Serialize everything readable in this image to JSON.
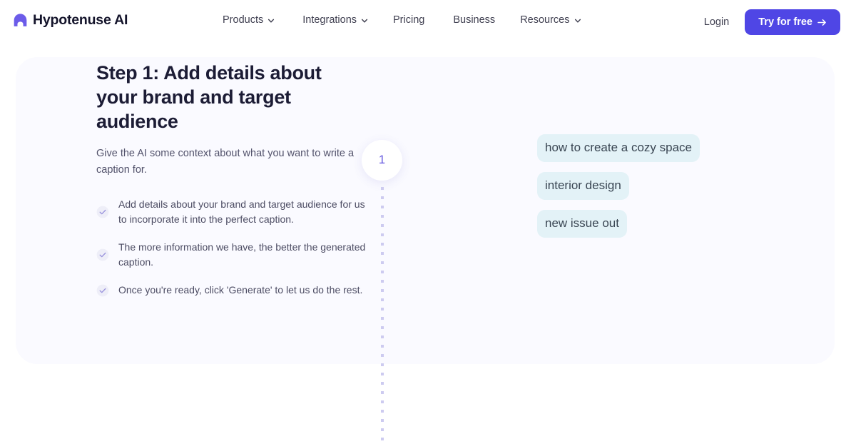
{
  "header": {
    "brand_name": "Hypotenuse AI",
    "brand_icon": "arch-logo-icon",
    "nav": [
      {
        "label": "Products",
        "has_dropdown": true,
        "icon": "chevron-down-icon"
      },
      {
        "label": "Integrations",
        "has_dropdown": true,
        "icon": "chevron-down-icon"
      },
      {
        "label": "Pricing",
        "has_dropdown": false,
        "icon": ""
      },
      {
        "label": "Business",
        "has_dropdown": false,
        "icon": ""
      },
      {
        "label": "Resources",
        "has_dropdown": true,
        "icon": "chevron-down-icon"
      }
    ],
    "login_label": "Login",
    "cta_label": "Try for free",
    "cta_icon": "arrow-right-icon",
    "cta_color": "#4f46e5"
  },
  "panel": {
    "background": "#fafaff",
    "title": "Step 1: Add details about your brand and target audience",
    "subtitle": "Give the AI some context about what you want to write a caption for.",
    "checklist": [
      {
        "icon": "check-circle-icon",
        "text": "Add details about your brand and target audience for us to incorporate it into the perfect caption."
      },
      {
        "icon": "check-circle-icon",
        "text": "The more information we have, the better the generated caption."
      },
      {
        "icon": "check-circle-icon",
        "text": "Once you're ready, click 'Generate' to let us do the rest."
      }
    ],
    "timeline": {
      "step_number": "1",
      "step_number_color": "#6558e0",
      "dot_color": "#cdcbf0"
    },
    "captions": {
      "chip_color": "#e3f2f7",
      "items": [
        "how to create a cozy space",
        "interior design",
        "new issue out"
      ]
    }
  }
}
